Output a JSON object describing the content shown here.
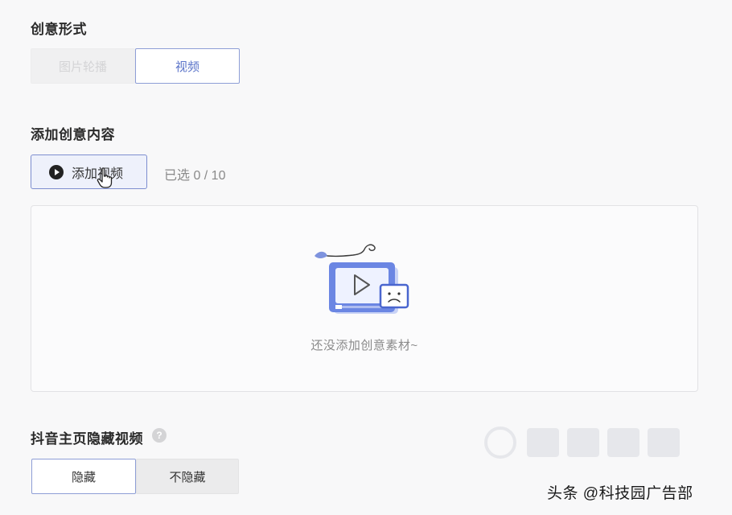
{
  "creative_format": {
    "title": "创意形式",
    "options": [
      {
        "label": "图片轮播",
        "state": "disabled"
      },
      {
        "label": "视频",
        "state": "selected"
      }
    ]
  },
  "add_content": {
    "title": "添加创意内容",
    "add_button_label": "添加视频",
    "selected_count": "已选 0 / 10",
    "empty_text": "还没添加创意素材~"
  },
  "hide_video": {
    "title": "抖音主页隐藏视频",
    "help_icon": "?",
    "options": [
      {
        "label": "隐藏",
        "state": "selected"
      },
      {
        "label": "不隐藏",
        "state": "unselected"
      }
    ]
  },
  "watermark": {
    "source": "头条 @科技园广告部"
  },
  "colors": {
    "accent": "#5b74c9",
    "accent_border": "#8e9ed6",
    "background": "#f8f8f9"
  }
}
